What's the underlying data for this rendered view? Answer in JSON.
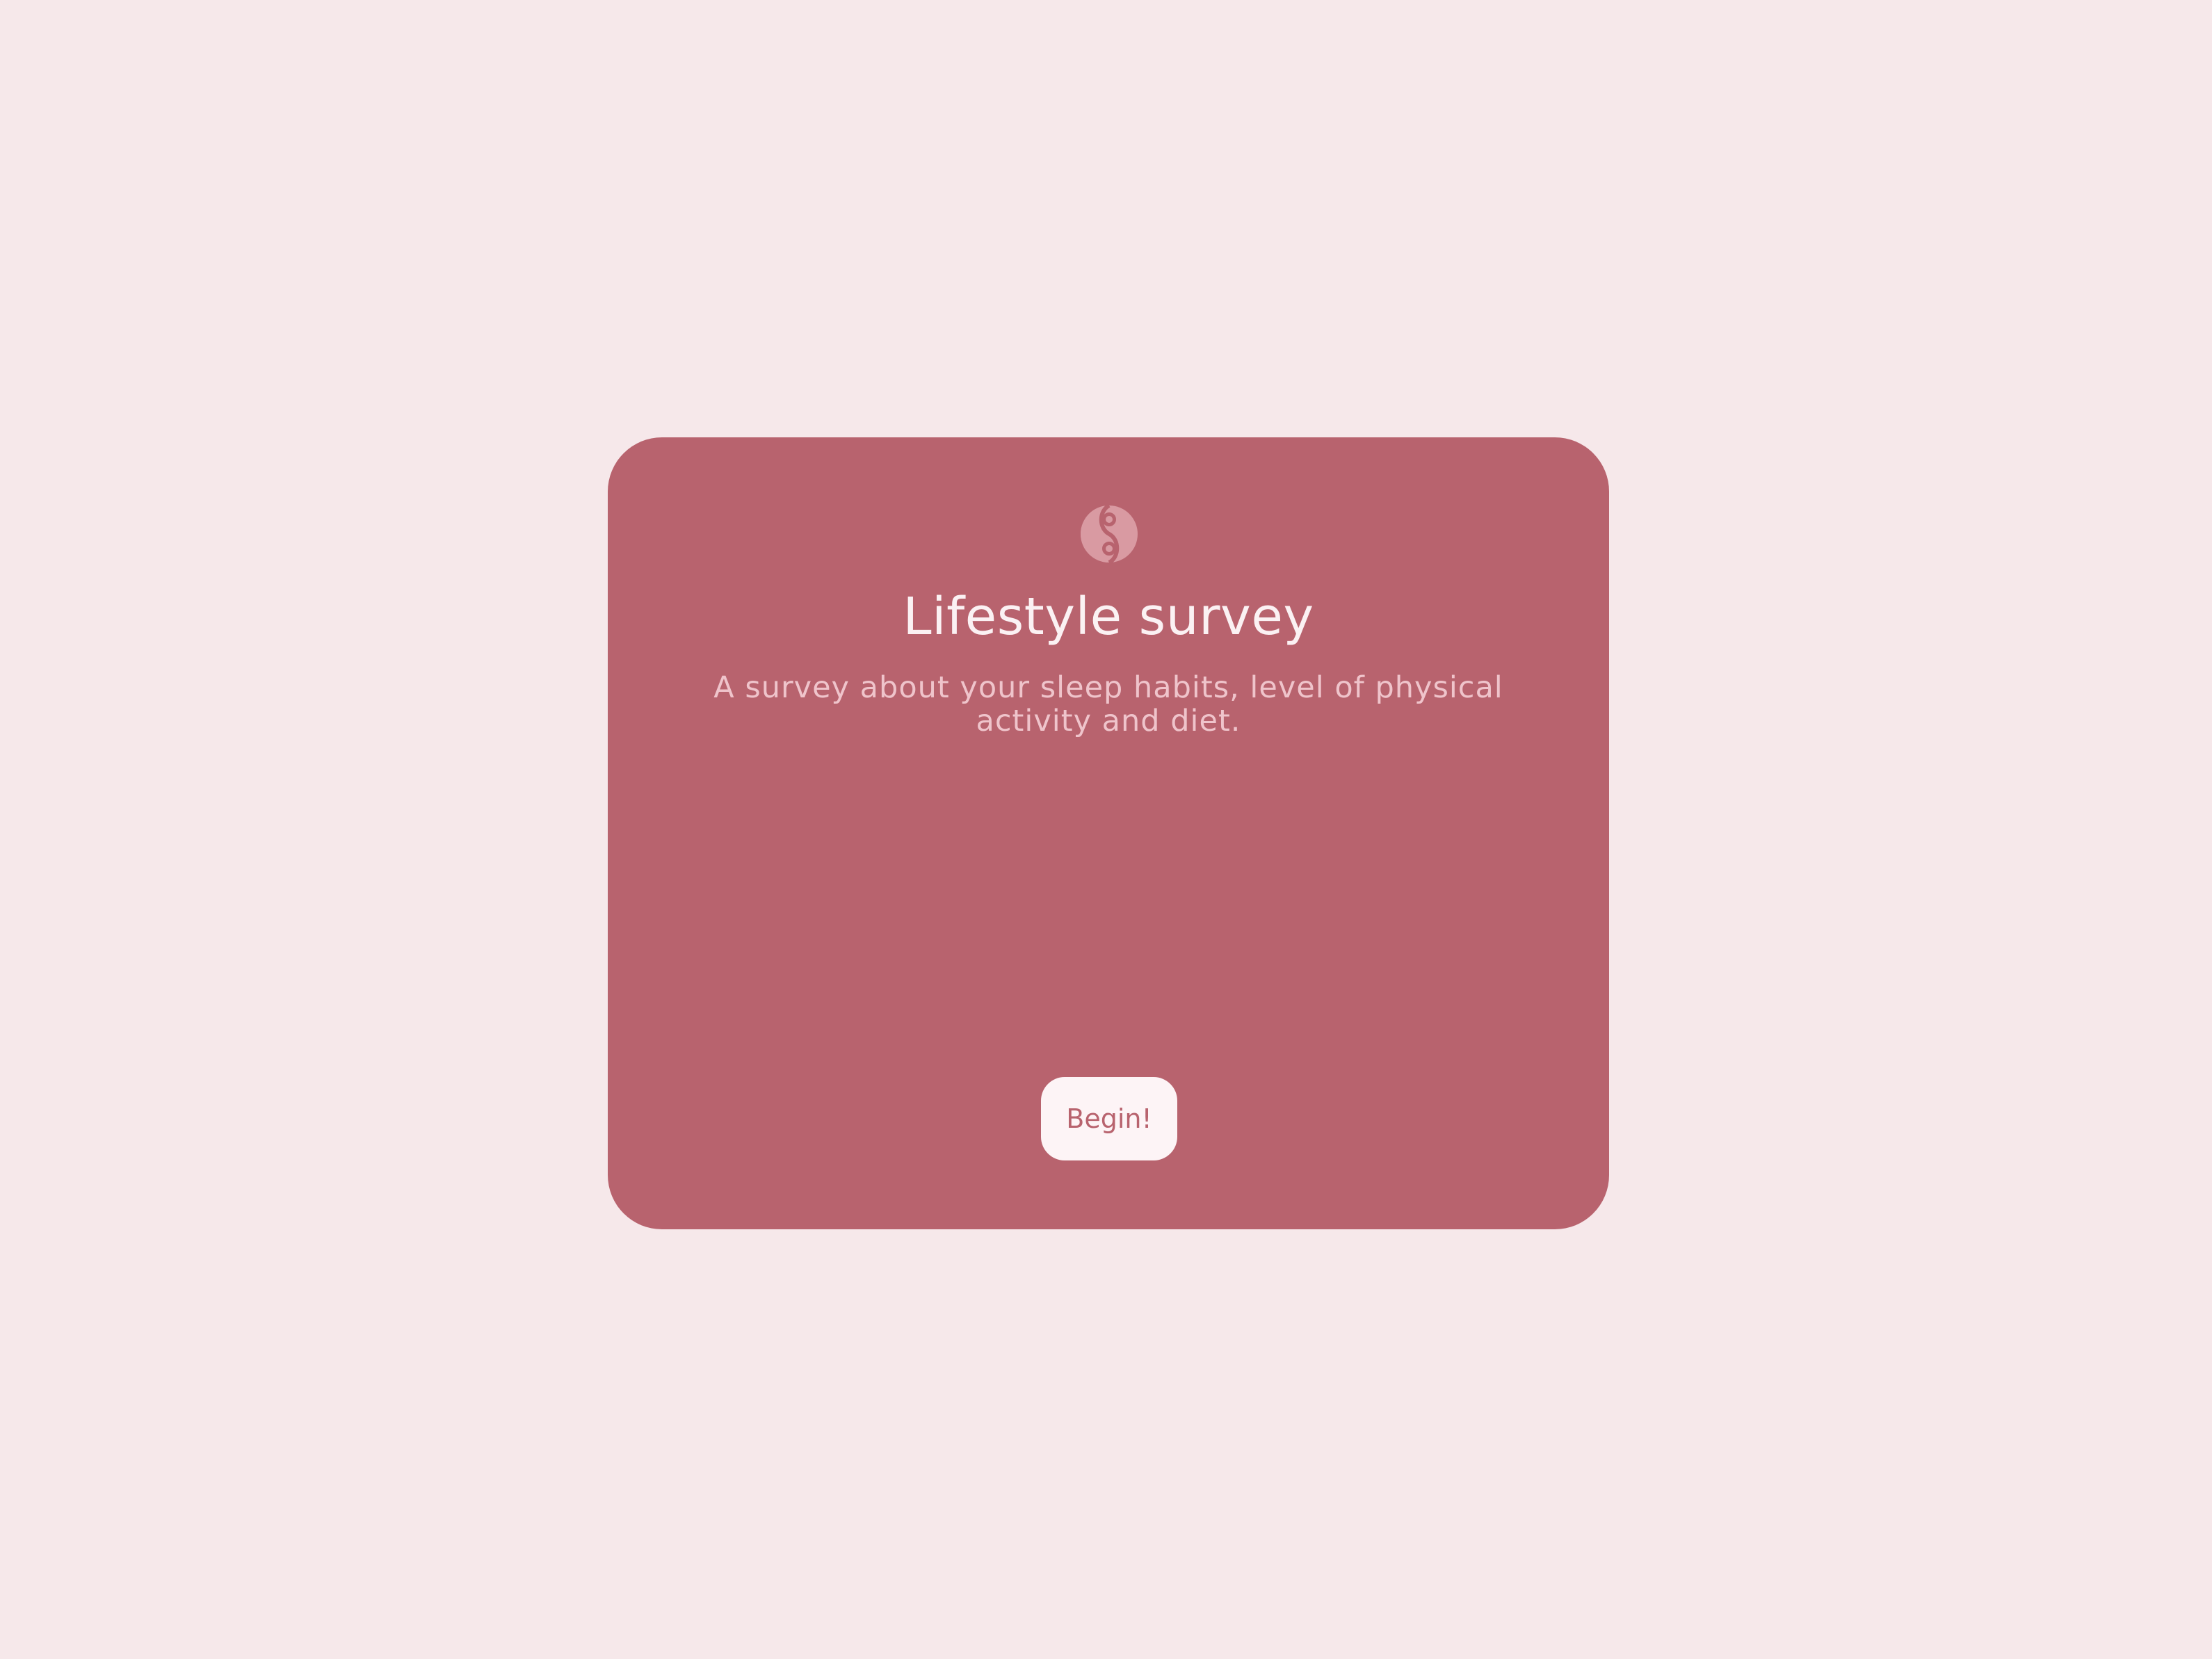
{
  "card": {
    "logo_icon": "yin-yang-icon",
    "title": "Lifestyle survey",
    "description": "A survey about your sleep habits, level of physical activity and diet.",
    "begin_label": "Begin!"
  },
  "colors": {
    "page_background": "#f6e8ea",
    "card_background": "#b8636e",
    "title_text": "#fbf1f3",
    "description_text": "#efc4cb",
    "button_background": "#fdf4f6",
    "button_text": "#b8636e",
    "logo_fill": "#d99aa2"
  }
}
